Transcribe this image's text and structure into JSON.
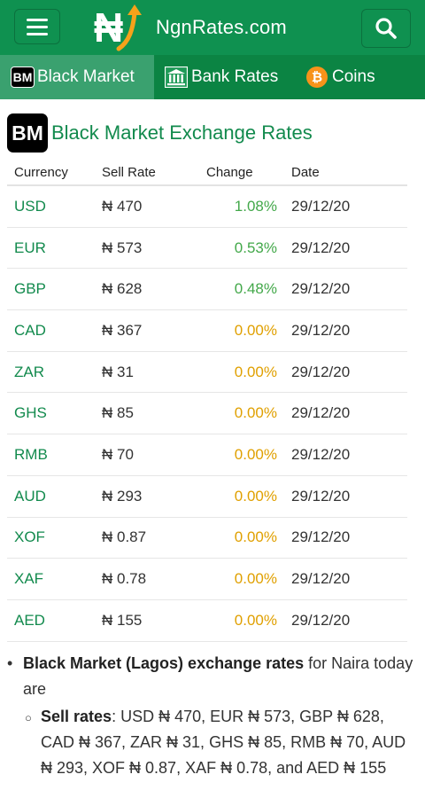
{
  "header": {
    "site_name": "NgnRates.com",
    "logo_symbol": "₦",
    "menu_icon": "hamburger-icon",
    "search_icon": "search-icon",
    "brand_color": "#0f9150"
  },
  "tabs": [
    {
      "badge": "BM",
      "label": "Black Market",
      "active": true
    },
    {
      "icon": "bank-icon",
      "label": "Bank Rates",
      "active": false
    },
    {
      "icon": "bitcoin-icon",
      "label": "Coins",
      "active": false
    }
  ],
  "heading": {
    "badge": "BM",
    "title": "Black Market Exchange Rates"
  },
  "table": {
    "headers": [
      "Currency",
      "Sell Rate",
      "Change",
      "Date"
    ],
    "rows": [
      {
        "currency": "USD",
        "sell": "₦ 470",
        "change": "1.08%",
        "date": "29/12/20"
      },
      {
        "currency": "EUR",
        "sell": "₦ 573",
        "change": "0.53%",
        "date": "29/12/20"
      },
      {
        "currency": "GBP",
        "sell": "₦ 628",
        "change": "0.48%",
        "date": "29/12/20"
      },
      {
        "currency": "CAD",
        "sell": "₦ 367",
        "change": "0.00%",
        "date": "29/12/20"
      },
      {
        "currency": "ZAR",
        "sell": "₦ 31",
        "change": "0.00%",
        "date": "29/12/20"
      },
      {
        "currency": "GHS",
        "sell": "₦ 85",
        "change": "0.00%",
        "date": "29/12/20"
      },
      {
        "currency": "RMB",
        "sell": "₦ 70",
        "change": "0.00%",
        "date": "29/12/20"
      },
      {
        "currency": "AUD",
        "sell": "₦ 293",
        "change": "0.00%",
        "date": "29/12/20"
      },
      {
        "currency": "XOF",
        "sell": "₦ 0.87",
        "change": "0.00%",
        "date": "29/12/20"
      },
      {
        "currency": "XAF",
        "sell": "₦ 0.78",
        "change": "0.00%",
        "date": "29/12/20"
      },
      {
        "currency": "AED",
        "sell": "₦ 155",
        "change": "0.00%",
        "date": "29/12/20"
      }
    ],
    "colors": {
      "positive": "#43a84a",
      "neutral": "#e0a000"
    }
  },
  "summary": {
    "title_bold": "Black Market (Lagos) exchange rates",
    "title_rest": " for Naira today are",
    "sell_label": "Sell rates",
    "sell_text": ": USD ₦ 470, EUR ₦ 573, GBP ₦ 628, CAD ₦ 367, ZAR ₦ 31, GHS ₦ 85, RMB ₦ 70, AUD ₦ 293, XOF ₦ 0.87, XAF ₦ 0.78, and AED ₦ 155"
  }
}
